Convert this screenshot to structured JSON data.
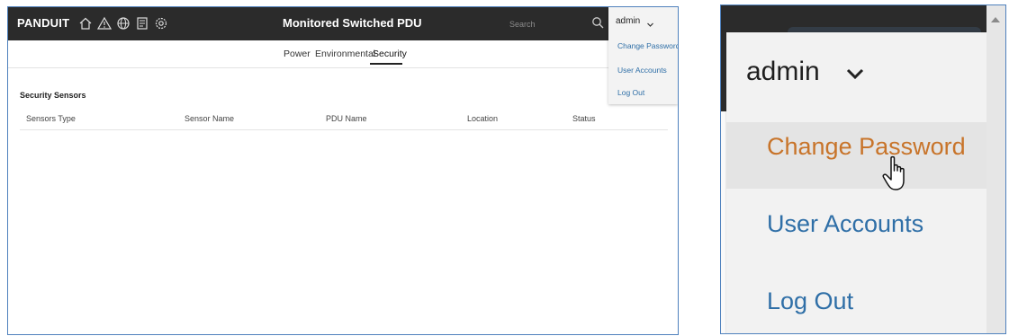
{
  "left_panel": {
    "header": {
      "logo_text": "PANDUIT",
      "title": "Monitored Switched PDU",
      "search_placeholder": "Search",
      "nav_icons": [
        "home-icon",
        "alert-icon",
        "globe-icon",
        "document-icon",
        "settings-icon"
      ]
    },
    "user_menu": {
      "username": "admin",
      "items": [
        "Change Password",
        "User Accounts",
        "Log Out"
      ]
    },
    "tabs": [
      "Power",
      "Environmental",
      "Security"
    ],
    "active_tab": "Security",
    "section": {
      "title": "Security Sensors",
      "columns": [
        "Sensors Type",
        "Sensor Name",
        "PDU Name",
        "Location",
        "Status"
      ]
    }
  },
  "right_panel": {
    "user_menu": {
      "username": "admin",
      "items": [
        "Change Password",
        "User Accounts",
        "Log Out"
      ],
      "hovered_item": "Change Password"
    }
  },
  "colors": {
    "header_bg": "#2b2b2b",
    "link_blue": "#2f6fa7",
    "hover_orange": "#c8742a",
    "panel_border": "#4f81bd"
  }
}
